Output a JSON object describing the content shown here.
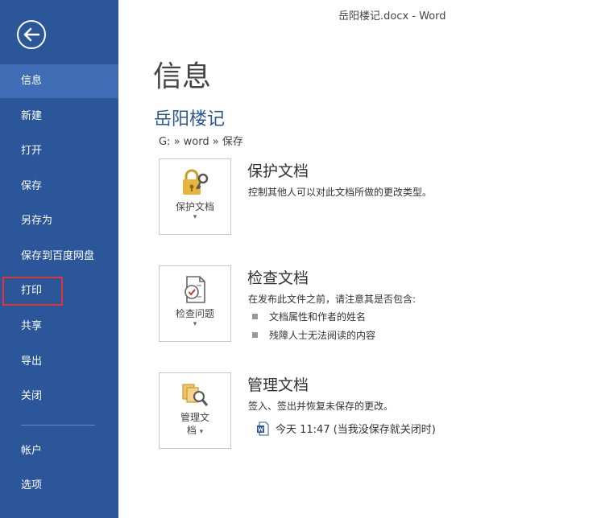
{
  "window": {
    "title": "岳阳楼记.docx - Word"
  },
  "sidebar": {
    "back_icon": "back-arrow-icon",
    "items": [
      {
        "label": "信息"
      },
      {
        "label": "新建"
      },
      {
        "label": "打开"
      },
      {
        "label": "保存"
      },
      {
        "label": "另存为"
      },
      {
        "label": "保存到百度网盘"
      },
      {
        "label": "打印"
      },
      {
        "label": "共享"
      },
      {
        "label": "导出"
      },
      {
        "label": "关闭"
      }
    ],
    "bottom_items": [
      {
        "label": "帐户"
      },
      {
        "label": "选项"
      }
    ],
    "active_item": "信息",
    "highlighted_item": "打印"
  },
  "main": {
    "page_title": "信息",
    "doc_title": "岳阳楼记",
    "path": "G: » word » 保存",
    "sections": [
      {
        "card_label": "保护文档",
        "card_caret": "▾",
        "card_icon": "lock-key-icon",
        "title": "保护文档",
        "desc": "控制其他人可以对此文档所做的更改类型。"
      },
      {
        "card_label": "检查问题",
        "card_caret": "▾",
        "card_icon": "inspect-document-icon",
        "title": "检查文档",
        "desc": "在发布此文件之前，请注意其是否包含:",
        "bullets": [
          "文档属性和作者的姓名",
          "残障人士无法阅读的内容"
        ]
      },
      {
        "card_label_line1": "管理文",
        "card_label_line2": "档",
        "card_caret": "▾",
        "card_icon": "manage-document-icon",
        "title": "管理文档",
        "desc": "签入、签出并恢复未保存的更改。",
        "version_entry": "今天 11:47 (当我没保存就关闭时)",
        "version_icon": "word-document-icon"
      }
    ]
  },
  "colors": {
    "sidebar": "#2b579a",
    "active": "#3e6db5",
    "accent": "#2b579a",
    "highlight_border": "#e8323a"
  }
}
